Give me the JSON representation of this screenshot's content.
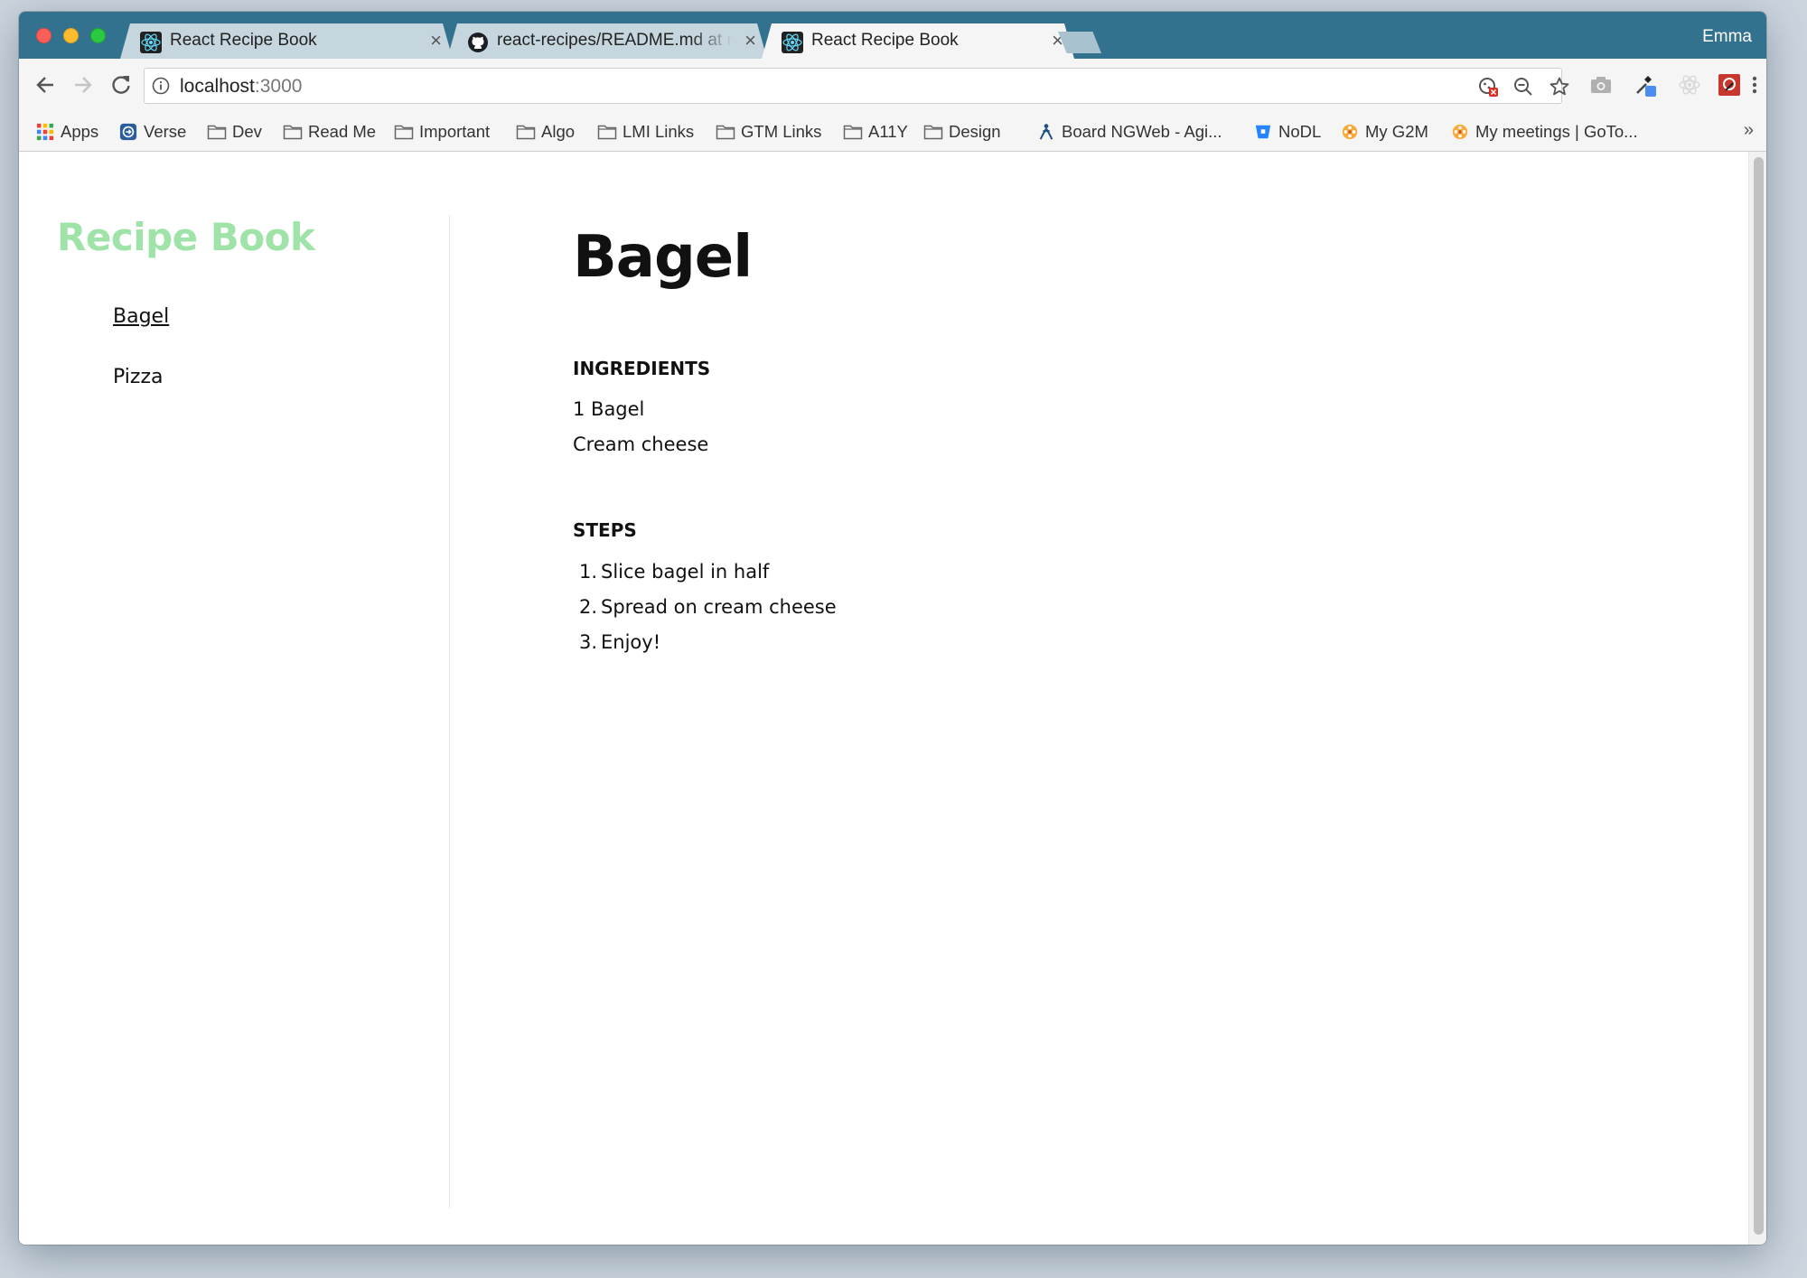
{
  "browser": {
    "profile_name": "Emma",
    "tabs": [
      {
        "title": "React Recipe Book",
        "favicon": "react-icon",
        "active": false
      },
      {
        "title": "react-recipes/README.md at m",
        "favicon": "github-icon",
        "active": false
      },
      {
        "title": "React Recipe Book",
        "favicon": "react-icon",
        "active": true
      }
    ],
    "address_bar": {
      "host": "localhost",
      "port": ":3000"
    },
    "bookmarks": [
      {
        "label": "Apps",
        "icon": "apps-grid-icon"
      },
      {
        "label": "Verse",
        "icon": "verse-icon"
      },
      {
        "label": "Dev",
        "icon": "folder-icon"
      },
      {
        "label": "Read Me",
        "icon": "folder-icon"
      },
      {
        "label": "Important",
        "icon": "folder-icon"
      },
      {
        "label": "Algo",
        "icon": "folder-icon"
      },
      {
        "label": "LMI Links",
        "icon": "folder-icon"
      },
      {
        "label": "GTM Links",
        "icon": "folder-icon"
      },
      {
        "label": "A11Y",
        "icon": "folder-icon"
      },
      {
        "label": "Design",
        "icon": "folder-icon"
      },
      {
        "label": "Board NGWeb - Agi...",
        "icon": "jira-icon"
      },
      {
        "label": "NoDL",
        "icon": "bitbucket-icon"
      },
      {
        "label": "My G2M",
        "icon": "gotomeeting-icon"
      },
      {
        "label": "My meetings | GoTo...",
        "icon": "gotomeeting-icon"
      }
    ],
    "bookmarks_overflow": "»",
    "colors": {
      "tab_strip": "#33728f",
      "brand_green": "#9fe3a9"
    }
  },
  "app": {
    "brand": "Recipe Book",
    "nav": [
      {
        "label": "Bagel",
        "current": true
      },
      {
        "label": "Pizza",
        "current": false
      }
    ],
    "recipe": {
      "title": "Bagel",
      "ingredients_heading": "INGREDIENTS",
      "ingredients": [
        "1 Bagel",
        "Cream cheese"
      ],
      "steps_heading": "STEPS",
      "steps": [
        "Slice bagel in half",
        "Spread on cream cheese",
        "Enjoy!"
      ]
    }
  }
}
